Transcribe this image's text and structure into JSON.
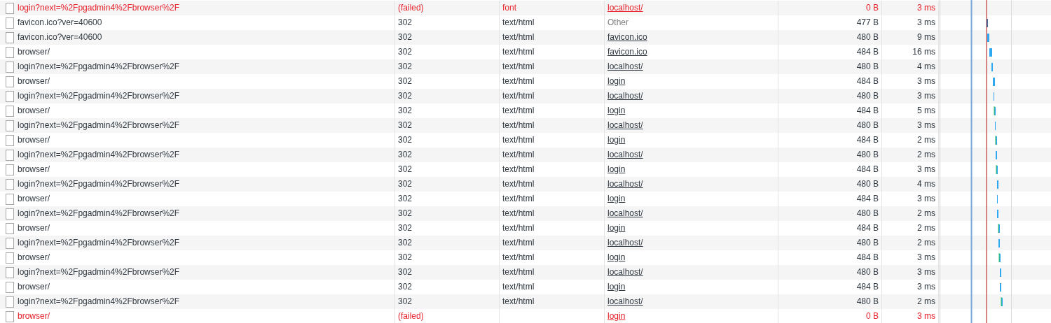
{
  "rows": [
    {
      "name": "login?next=%2Fpgadmin4%2Fbrowser%2F",
      "status": "(failed)",
      "type": "font",
      "initiator": "localhost/",
      "initiator_link": true,
      "size": "0 B",
      "time": "3 ms",
      "failed": true
    },
    {
      "name": "favicon.ico?ver=40600",
      "status": "302",
      "type": "text/html",
      "initiator": "Other",
      "initiator_link": false,
      "size": "477 B",
      "time": "3 ms",
      "failed": false
    },
    {
      "name": "favicon.ico?ver=40600",
      "status": "302",
      "type": "text/html",
      "initiator": "favicon.ico",
      "initiator_link": true,
      "size": "480 B",
      "time": "9 ms",
      "failed": false
    },
    {
      "name": "browser/",
      "status": "302",
      "type": "text/html",
      "initiator": "favicon.ico",
      "initiator_link": true,
      "size": "484 B",
      "time": "16 ms",
      "failed": false
    },
    {
      "name": "login?next=%2Fpgadmin4%2Fbrowser%2F",
      "status": "302",
      "type": "text/html",
      "initiator": "localhost/",
      "initiator_link": true,
      "size": "480 B",
      "time": "4 ms",
      "failed": false
    },
    {
      "name": "browser/",
      "status": "302",
      "type": "text/html",
      "initiator": "login",
      "initiator_link": true,
      "size": "484 B",
      "time": "3 ms",
      "failed": false
    },
    {
      "name": "login?next=%2Fpgadmin4%2Fbrowser%2F",
      "status": "302",
      "type": "text/html",
      "initiator": "localhost/",
      "initiator_link": true,
      "size": "480 B",
      "time": "3 ms",
      "failed": false
    },
    {
      "name": "browser/",
      "status": "302",
      "type": "text/html",
      "initiator": "login",
      "initiator_link": true,
      "size": "484 B",
      "time": "5 ms",
      "failed": false
    },
    {
      "name": "login?next=%2Fpgadmin4%2Fbrowser%2F",
      "status": "302",
      "type": "text/html",
      "initiator": "localhost/",
      "initiator_link": true,
      "size": "480 B",
      "time": "3 ms",
      "failed": false
    },
    {
      "name": "browser/",
      "status": "302",
      "type": "text/html",
      "initiator": "login",
      "initiator_link": true,
      "size": "484 B",
      "time": "2 ms",
      "failed": false
    },
    {
      "name": "login?next=%2Fpgadmin4%2Fbrowser%2F",
      "status": "302",
      "type": "text/html",
      "initiator": "localhost/",
      "initiator_link": true,
      "size": "480 B",
      "time": "2 ms",
      "failed": false
    },
    {
      "name": "browser/",
      "status": "302",
      "type": "text/html",
      "initiator": "login",
      "initiator_link": true,
      "size": "484 B",
      "time": "3 ms",
      "failed": false
    },
    {
      "name": "login?next=%2Fpgadmin4%2Fbrowser%2F",
      "status": "302",
      "type": "text/html",
      "initiator": "localhost/",
      "initiator_link": true,
      "size": "480 B",
      "time": "4 ms",
      "failed": false
    },
    {
      "name": "browser/",
      "status": "302",
      "type": "text/html",
      "initiator": "login",
      "initiator_link": true,
      "size": "484 B",
      "time": "3 ms",
      "failed": false
    },
    {
      "name": "login?next=%2Fpgadmin4%2Fbrowser%2F",
      "status": "302",
      "type": "text/html",
      "initiator": "localhost/",
      "initiator_link": true,
      "size": "480 B",
      "time": "2 ms",
      "failed": false
    },
    {
      "name": "browser/",
      "status": "302",
      "type": "text/html",
      "initiator": "login",
      "initiator_link": true,
      "size": "484 B",
      "time": "2 ms",
      "failed": false
    },
    {
      "name": "login?next=%2Fpgadmin4%2Fbrowser%2F",
      "status": "302",
      "type": "text/html",
      "initiator": "localhost/",
      "initiator_link": true,
      "size": "480 B",
      "time": "2 ms",
      "failed": false
    },
    {
      "name": "browser/",
      "status": "302",
      "type": "text/html",
      "initiator": "login",
      "initiator_link": true,
      "size": "484 B",
      "time": "3 ms",
      "failed": false
    },
    {
      "name": "login?next=%2Fpgadmin4%2Fbrowser%2F",
      "status": "302",
      "type": "text/html",
      "initiator": "localhost/",
      "initiator_link": true,
      "size": "480 B",
      "time": "3 ms",
      "failed": false
    },
    {
      "name": "browser/",
      "status": "302",
      "type": "text/html",
      "initiator": "login",
      "initiator_link": true,
      "size": "484 B",
      "time": "3 ms",
      "failed": false
    },
    {
      "name": "login?next=%2Fpgadmin4%2Fbrowser%2F",
      "status": "302",
      "type": "text/html",
      "initiator": "localhost/",
      "initiator_link": true,
      "size": "480 B",
      "time": "2 ms",
      "failed": false
    },
    {
      "name": "browser/",
      "status": "(failed)",
      "initiator": "login",
      "initiator_link": true,
      "size": "0 B",
      "time": "3 ms",
      "failed": true
    }
  ]
}
